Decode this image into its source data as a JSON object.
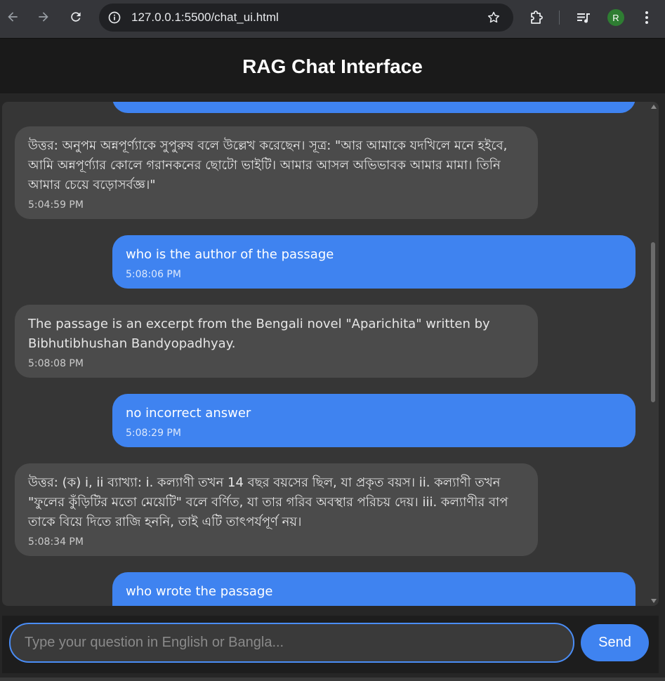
{
  "browser": {
    "url": "127.0.0.1:5500/chat_ui.html",
    "profile_initial": "R"
  },
  "app": {
    "title": "RAG Chat Interface"
  },
  "messages": [
    {
      "role": "user",
      "text": "",
      "time": ""
    },
    {
      "role": "bot",
      "text": "উত্তর: অনুপম অন্নপূর্ণ্যাকে সুপুরুষ বলে উল্লেখ করেছেন। সূত্র: \"আর আমাকে যদখিলে মনে হইবে, আমি অন্নপূর্ণ্যার কোলে গরানকনের ছোটো ভাইটি। আমার আসল অভিভাবক আমার মামা। তিনি আমার চেয়ে বড়োসর্বজ্ঞ।\"",
      "time": "5:04:59 PM"
    },
    {
      "role": "user",
      "text": "who is the author of the passage",
      "time": "5:08:06 PM"
    },
    {
      "role": "bot",
      "text": "The passage is an excerpt from the Bengali novel \"Aparichita\" written by Bibhutibhushan Bandyopadhyay.",
      "time": "5:08:08 PM"
    },
    {
      "role": "user",
      "text": "no incorrect answer",
      "time": "5:08:29 PM"
    },
    {
      "role": "bot",
      "text": "উত্তর: (ক) i, ii ব্যাখ্যা: i. কল্যাণী তখন 14 বছর বয়সের ছিল, যা প্রকৃত বয়স। ii. কল্যাণী তখন \"ফুলের কুঁড়িটির মতো মেয়েটি\" বলে বর্ণিত, যা তার গরিব অবস্থার পরিচয় দেয়। iii. কল্যাণীর বাপ তাকে বিয়ে দিতে রাজি হননি, তাই এটি তাৎপর্যপূর্ণ নয়।",
      "time": "5:08:34 PM"
    },
    {
      "role": "user",
      "text": "who wrote the passage",
      "time": ""
    }
  ],
  "composer": {
    "placeholder": "Type your question in English or Bangla...",
    "value": "",
    "send_label": "Send"
  },
  "colors": {
    "user_bubble": "#3f83f0",
    "bot_bubble": "#4b4b4b",
    "input_border": "#4a8df6"
  }
}
